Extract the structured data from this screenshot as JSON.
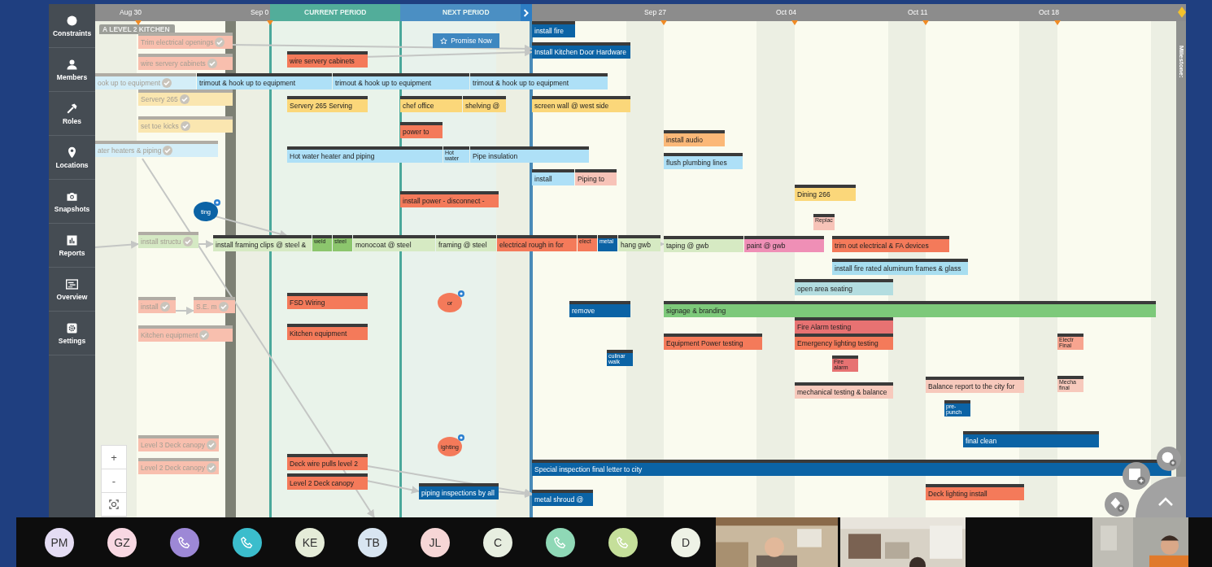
{
  "sidebar": {
    "items": [
      {
        "label": "Constraints"
      },
      {
        "label": "Members"
      },
      {
        "label": "Roles"
      },
      {
        "label": "Locations"
      },
      {
        "label": "Snapshots"
      },
      {
        "label": "Reports"
      },
      {
        "label": "Overview"
      },
      {
        "label": "Settings"
      }
    ]
  },
  "timeline_header": [
    {
      "kind": "date",
      "text": "Aug 30"
    },
    {
      "kind": "date",
      "text": "Sep 0"
    },
    {
      "kind": "period",
      "text": "CURRENT PERIOD"
    },
    {
      "kind": "period",
      "text": "NEXT PERIOD"
    },
    {
      "kind": "date",
      "text": "Sep 27"
    },
    {
      "kind": "date",
      "text": "Oct 04"
    },
    {
      "kind": "date",
      "text": "Oct 11"
    },
    {
      "kind": "date",
      "text": "Oct 18"
    }
  ],
  "lane_label": "A LEVEL 2 KITCHEN",
  "promise_button": "Promise Now",
  "milestone_label": "Milestone:",
  "cards": [
    {
      "text": "Trim electrical openings",
      "color": "#f8bfae",
      "completed": true
    },
    {
      "text": "wire servery cabinets",
      "color": "#f8bfae",
      "completed": true
    },
    {
      "text": "ook up to equipment",
      "color": "#d4eef8",
      "completed": true
    },
    {
      "text": "Servery 265",
      "color": "#fae6b0",
      "completed": true
    },
    {
      "text": "set toe kicks",
      "color": "#fae6b0",
      "completed": true
    },
    {
      "text": "ater heaters & piping",
      "color": "#d4eef8",
      "completed": true
    },
    {
      "text": "install structu",
      "color": "#d5e9c4",
      "completed": true
    },
    {
      "text": "install",
      "color": "#f8bfae",
      "completed": true
    },
    {
      "text": "S.E. m",
      "color": "#f8bfae",
      "completed": true
    },
    {
      "text": "Kitchen equipment",
      "color": "#f8bfae",
      "completed": true
    },
    {
      "text": "Level 3 Deck canopy",
      "color": "#f8bfae",
      "completed": true
    },
    {
      "text": "Level 2 Deck canopy",
      "color": "#f8bfae",
      "completed": true
    },
    {
      "text": "wire servery cabinets",
      "color": "#f47a5a",
      "completed": false
    },
    {
      "text": "trimout & hook up to equipment",
      "color": "#aee0f7",
      "completed": false
    },
    {
      "text": "trimout & hook up to equipment",
      "color": "#aee0f7",
      "completed": false
    },
    {
      "text": "trimout & hook up to equipment",
      "color": "#aee0f7",
      "completed": false
    },
    {
      "text": "Servery 265 Serving",
      "color": "#fbd77a",
      "completed": false
    },
    {
      "text": "chef office",
      "color": "#fbd77a",
      "completed": false
    },
    {
      "text": "shelving @",
      "color": "#fbd77a",
      "completed": false
    },
    {
      "text": "power to",
      "color": "#f47a5a",
      "completed": false
    },
    {
      "text": "Hot water heater and piping",
      "color": "#aee0f7",
      "completed": false
    },
    {
      "text": "Hot water",
      "color": "#aee0f7",
      "completed": false
    },
    {
      "text": "Pipe insulation",
      "color": "#aee0f7",
      "completed": false
    },
    {
      "text": "install power - disconnect -",
      "color": "#f47a5a",
      "completed": false
    },
    {
      "text": "install fire",
      "color": "#0b63a5",
      "completed": false
    },
    {
      "text": "Install Kitchen Door Hardware",
      "color": "#0b63a5",
      "completed": false
    },
    {
      "text": "screen wall @ west side",
      "color": "#fbd77a",
      "completed": false
    },
    {
      "text": "install",
      "color": "#aee0f7",
      "completed": false
    },
    {
      "text": "Piping to",
      "color": "#f7c3b8",
      "completed": false
    },
    {
      "text": "install audio",
      "color": "#fbb878",
      "completed": false
    },
    {
      "text": "flush plumbing lines",
      "color": "#aee0f7",
      "completed": false
    },
    {
      "text": "Dining 266",
      "color": "#fbd77a",
      "completed": false
    },
    {
      "text": "Replac",
      "color": "#f7c3b8",
      "completed": false
    },
    {
      "text": "install framing clips @ steel &",
      "color": "#d6eac3",
      "completed": false
    },
    {
      "text": "weld",
      "color": "#8cc66d",
      "completed": false
    },
    {
      "text": "steel",
      "color": "#8cc66d",
      "completed": false
    },
    {
      "text": "monocoat @ steel",
      "color": "#d6eac3",
      "completed": false
    },
    {
      "text": "framing @ steel",
      "color": "#d6eac3",
      "completed": false
    },
    {
      "text": "electrical rough in for",
      "color": "#f47a5a",
      "completed": false
    },
    {
      "text": "elect",
      "color": "#f47a5a",
      "completed": false
    },
    {
      "text": "metal",
      "color": "#0b63a5",
      "completed": false
    },
    {
      "text": "hang gwb",
      "color": "#d6eac3",
      "completed": false
    },
    {
      "text": "taping @ gwb",
      "color": "#d6eac3",
      "completed": false
    },
    {
      "text": "paint @ gwb",
      "color": "#ef8fb6",
      "completed": false
    },
    {
      "text": "trim out electrical & FA devices",
      "color": "#f47a5a",
      "completed": false
    },
    {
      "text": "install fire rated aluminum frames & glass",
      "color": "#a8def0",
      "completed": false
    },
    {
      "text": "open area seating",
      "color": "#b3dde0",
      "completed": false
    },
    {
      "text": "FSD Wiring",
      "color": "#f47a5a",
      "completed": false
    },
    {
      "text": "remove",
      "color": "#0b63a5",
      "completed": false
    },
    {
      "text": "signage & branding",
      "color": "#7dc97a",
      "completed": false
    },
    {
      "text": "Fire Alarm testing",
      "color": "#e77272",
      "completed": false
    },
    {
      "text": "Kitchen equipment",
      "color": "#f47a5a",
      "completed": false
    },
    {
      "text": "Equipment Power testing",
      "color": "#f47a5a",
      "completed": false
    },
    {
      "text": "Emergency lighting testing",
      "color": "#f47a5a",
      "completed": false
    },
    {
      "text": "Electr Final",
      "color": "#f7a48f",
      "completed": false
    },
    {
      "text": "culinar walk",
      "color": "#0b63a5",
      "completed": false
    },
    {
      "text": "Fire alarm",
      "color": "#e77272",
      "completed": false
    },
    {
      "text": "mechanical testing & balance",
      "color": "#f7c9bc",
      "completed": false
    },
    {
      "text": "Balance report to the city for",
      "color": "#f7c9bc",
      "completed": false
    },
    {
      "text": "Mecha final",
      "color": "#f7c9bc",
      "completed": false
    },
    {
      "text": "pre-punch",
      "color": "#0b63a5",
      "completed": false
    },
    {
      "text": "final clean",
      "color": "#0b63a5",
      "completed": false
    },
    {
      "text": "Deck wire pulls level 2",
      "color": "#f47a5a",
      "completed": false
    },
    {
      "text": "Level 2 Deck canopy",
      "color": "#f47a5a",
      "completed": false
    },
    {
      "text": "piping inspections by all",
      "color": "#0b63a5",
      "completed": false
    },
    {
      "text": "Special inspection final letter to city",
      "color": "#0b63a5",
      "completed": false
    },
    {
      "text": "metal shroud @",
      "color": "#0b63a5",
      "completed": false
    },
    {
      "text": "Deck lighting install",
      "color": "#f47a5a",
      "completed": false
    }
  ],
  "markers": [
    {
      "text": "ting",
      "color": "#0b63a5"
    },
    {
      "text": "or",
      "color": "#f47a5a"
    },
    {
      "text": "ighting",
      "color": "#f47a5a"
    }
  ],
  "zoom_controls": [
    "+",
    "-"
  ],
  "participants": [
    {
      "kind": "initials",
      "initials": "PM",
      "color": "#e4dcf3"
    },
    {
      "kind": "initials",
      "initials": "GZ",
      "color": "#f8d8e2"
    },
    {
      "kind": "phone",
      "color": "#9d88d6"
    },
    {
      "kind": "phone",
      "color": "#3bbdcc"
    },
    {
      "kind": "initials",
      "initials": "KE",
      "color": "#e5ecd8"
    },
    {
      "kind": "initials",
      "initials": "TB",
      "color": "#d8e5f1"
    },
    {
      "kind": "initials",
      "initials": "JL",
      "color": "#f6d6d6"
    },
    {
      "kind": "initials",
      "initials": "C",
      "color": "#e7eee0"
    },
    {
      "kind": "phone",
      "color": "#8fd8b6"
    },
    {
      "kind": "phone",
      "color": "#c5df9a"
    },
    {
      "kind": "initials",
      "initials": "D",
      "color": "#eef2e6"
    }
  ],
  "video_tiles": [
    {
      "kind": "picture"
    },
    {
      "kind": "picture"
    },
    {
      "kind": "picture"
    }
  ]
}
